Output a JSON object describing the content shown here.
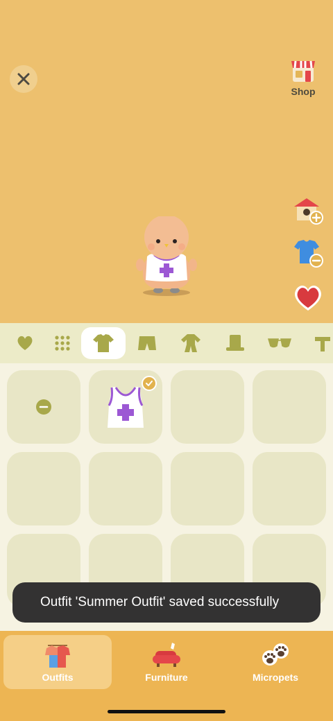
{
  "header": {
    "close_icon": "close-icon",
    "shop_label": "Shop"
  },
  "side_actions": [
    {
      "name": "add-home-icon"
    },
    {
      "name": "remove-outfit-icon"
    },
    {
      "name": "heart-icon"
    }
  ],
  "categories": [
    {
      "name": "favorites",
      "icon": "heart-icon"
    },
    {
      "name": "all",
      "icon": "grid-dots-icon"
    },
    {
      "name": "shirts",
      "icon": "shirt-icon",
      "active": true
    },
    {
      "name": "pants",
      "icon": "shorts-icon"
    },
    {
      "name": "suits",
      "icon": "onesie-icon"
    },
    {
      "name": "hats",
      "icon": "top-hat-icon"
    },
    {
      "name": "glasses",
      "icon": "sunglasses-icon"
    },
    {
      "name": "scarves",
      "icon": "scarf-icon"
    }
  ],
  "slots": [
    {
      "type": "remove"
    },
    {
      "type": "item",
      "item": "tank-top-with-cross",
      "selected": true
    },
    {
      "type": "empty"
    },
    {
      "type": "empty"
    },
    {
      "type": "empty"
    },
    {
      "type": "empty"
    },
    {
      "type": "empty"
    },
    {
      "type": "empty"
    },
    {
      "type": "empty"
    },
    {
      "type": "empty"
    },
    {
      "type": "empty"
    },
    {
      "type": "empty"
    }
  ],
  "toast": {
    "message": "Outfit 'Summer Outfit' saved successfully"
  },
  "bottom_nav": {
    "items": [
      {
        "label": "Outfits",
        "icon": "outfits-icon",
        "active": true
      },
      {
        "label": "Furniture",
        "icon": "sofa-icon"
      },
      {
        "label": "Micropets",
        "icon": "paw-icon"
      }
    ]
  },
  "colors": {
    "scene_bg": "#edc06e",
    "category_bar": "#ecebc8",
    "slot_bg": "#e8e6c6",
    "toast_bg": "#333232",
    "nav_bg": "#edb553",
    "accent_purple": "#9c58d4"
  }
}
